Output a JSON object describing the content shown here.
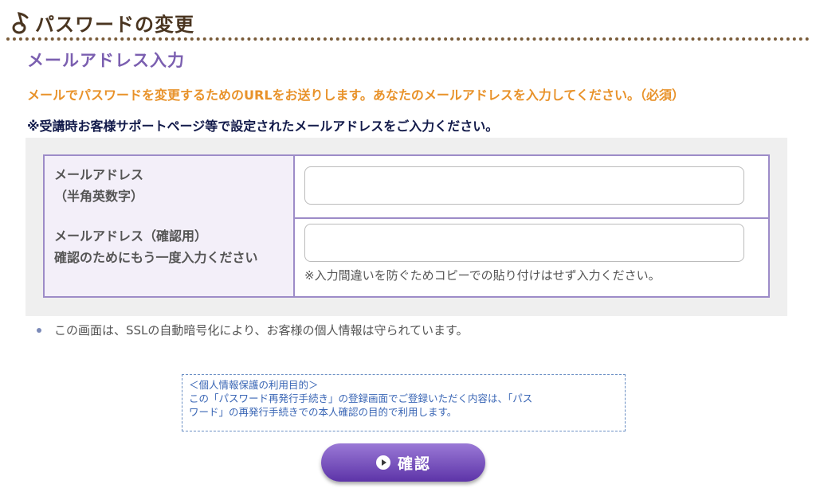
{
  "header": {
    "title": "パスワードの変更",
    "icon": "music-note-icon"
  },
  "section": {
    "heading": "メールアドレス入力"
  },
  "instruction": "メールでパスワードを変更するためのURLをお送りします。あなたのメールアドレスを入力してください。（必須）",
  "notice": "※受講時お客様サポートページ等で設定されたメールアドレスをご入力ください。",
  "form": {
    "email": {
      "label_line1": "メールアドレス",
      "label_line2": "（半角英数字）",
      "value": "",
      "placeholder": ""
    },
    "email_confirm": {
      "label_line1": "メールアドレス（確認用）",
      "label_line2": "確認のためにもう一度入力ください",
      "value": "",
      "placeholder": "",
      "hint": "※入力間違いを防ぐためコピーでの貼り付けはせず入力ください。"
    }
  },
  "security_note": "この画面は、SSLの自動暗号化により、お客様の個人情報は守られています。",
  "privacy": {
    "line1": "＜個人情報保護の利用目的＞",
    "line2": "この「パスワード再発行手続き」の登録画面でご登録いただく内容は、「パス",
    "line3": "ワード」の再発行手続きでの本人確認の目的で利用します。"
  },
  "confirm_button": {
    "label": "確認",
    "icon": "play-circle-icon"
  },
  "colors": {
    "accent": "#7b5fb0",
    "instruction": "#e8922a",
    "border": "#9d8cc8",
    "title": "#4a3520"
  }
}
